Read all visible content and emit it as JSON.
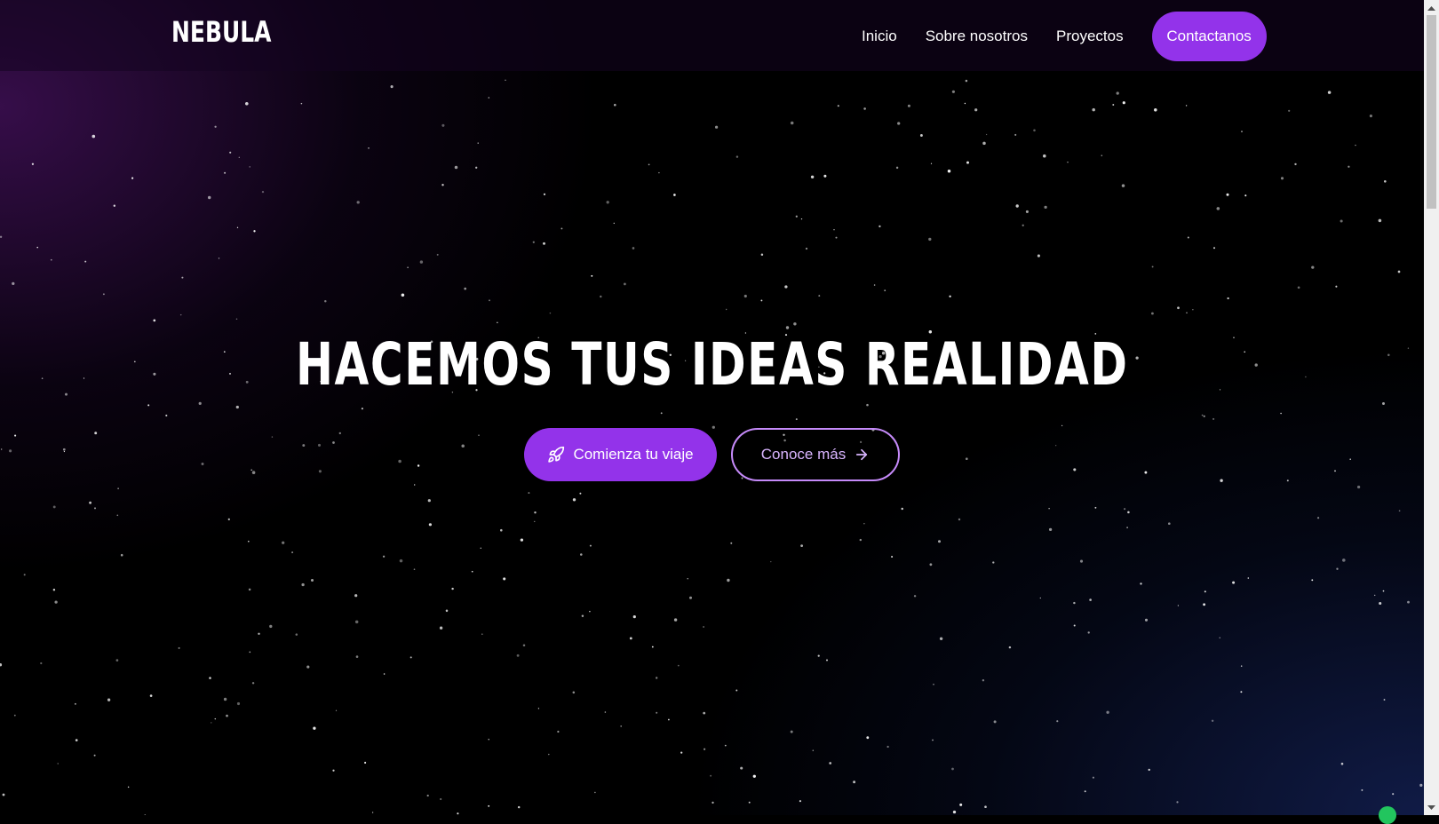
{
  "navbar": {
    "logo": "NEBULA",
    "links": [
      {
        "label": "Inicio"
      },
      {
        "label": "Sobre nosotros"
      },
      {
        "label": "Proyectos"
      }
    ],
    "cta_label": "Contactanos"
  },
  "hero": {
    "title": "HACEMOS TUS IDEAS REALIDAD",
    "primary_button": {
      "label": "Comienza tu viaje",
      "icon": "rocket-icon"
    },
    "secondary_button": {
      "label": "Conoce más",
      "icon": "arrow-right-icon"
    }
  },
  "colors": {
    "accent": "#9333ea",
    "outline": "#c58af9",
    "outline_text": "#d8b4fe",
    "chat_dot": "#22c55e"
  }
}
